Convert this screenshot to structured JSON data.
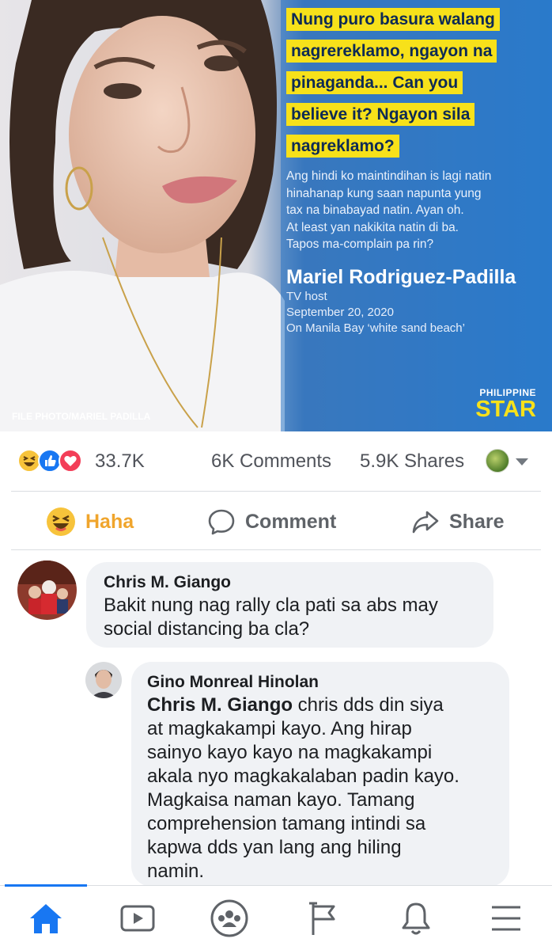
{
  "post_image": {
    "headline_lines": [
      "Nung puro basura walang",
      "nagrereklamo, ngayon na",
      "pinaganda... Can you",
      "believe it? Ngayon sila",
      "nagreklamo?"
    ],
    "body_lines": [
      "Ang hindi ko maintindihan is lagi natin",
      "hinahanap kung saan napunta yung",
      "tax na binabayad natin. Ayan oh.",
      "At least yan nakikita natin di ba.",
      "Tapos ma-complain pa rin?"
    ],
    "author": "Mariel Rodriguez-Padilla",
    "role": "TV host",
    "date": "September 20, 2020",
    "context": "On Manila Bay ‘white sand beach’",
    "photo_credit": "FILE PHOTO/MARIEL PADILLA",
    "logo_top": "PHILIPPINE",
    "logo_bottom": "STAR",
    "colors": {
      "highlight": "#f7e11a",
      "background": "#2c7fd0"
    }
  },
  "stats": {
    "reaction_icons": [
      "haha-icon",
      "like-icon",
      "love-icon"
    ],
    "reaction_count": "33.7K",
    "comments": "6K Comments",
    "shares": "5.9K Shares"
  },
  "actions": {
    "haha": "Haha",
    "comment": "Comment",
    "share": "Share"
  },
  "comments": [
    {
      "name": "Chris M. Giango",
      "lines": [
        "Bakit nung nag rally cla pati sa abs may",
        "social distancing ba cla?"
      ]
    },
    {
      "name": "Gino Monreal Hinolan",
      "mention": "Chris M. Giango",
      "first_line_rest": " chris dds din siya",
      "lines": [
        "at magkakampi kayo. Ang hirap",
        "sainyo kayo kayo na magkakampi",
        "akala nyo magkakalaban padin kayo.",
        "Magkaisa naman kayo. Tamang",
        "comprehension tamang intindi sa",
        "kapwa dds yan lang ang hiling",
        "namin."
      ]
    }
  ],
  "nav": [
    "home-icon",
    "watch-icon",
    "groups-icon",
    "pages-flag-icon",
    "notifications-bell-icon",
    "menu-icon"
  ]
}
